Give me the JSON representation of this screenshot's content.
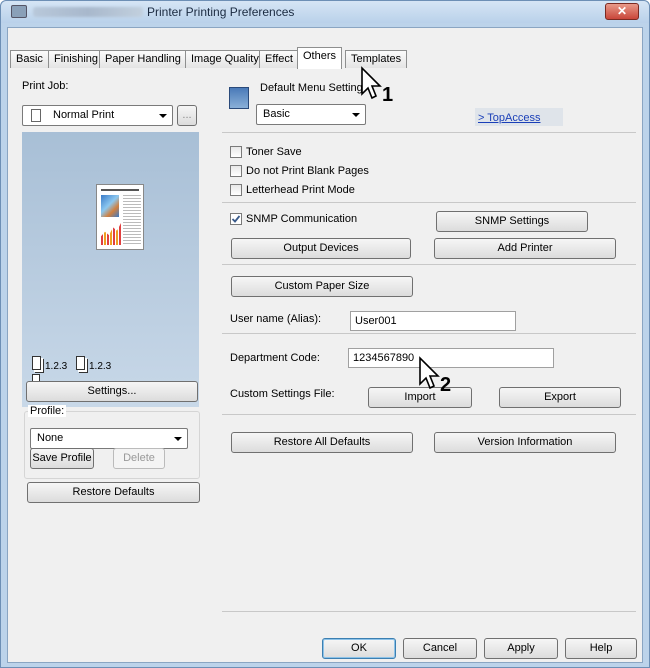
{
  "window": {
    "title": "Printer Printing Preferences",
    "close_label": "✕"
  },
  "tabs": [
    "Basic",
    "Finishing",
    "Paper Handling",
    "Image Quality",
    "Effect",
    "Others",
    "Templates"
  ],
  "left": {
    "print_job_label": "Print Job:",
    "print_job_value": "Normal Print",
    "print_job_more": "...",
    "preview_counts": [
      "1.2.3",
      "1.2.3"
    ],
    "settings_button": "Settings...",
    "profile_label": "Profile:",
    "profile_value": "None",
    "save_profile": "Save Profile",
    "delete": "Delete",
    "restore_defaults": "Restore Defaults"
  },
  "main": {
    "default_menu_label": "Default Menu Setting",
    "default_menu_value": "Basic",
    "topaccess_link": "> TopAccess",
    "toner_save": "Toner Save",
    "no_blank_pages": "Do not Print Blank Pages",
    "letterhead": "Letterhead Print Mode",
    "snmp_communication": "SNMP Communication",
    "snmp_settings": "SNMP Settings",
    "output_devices": "Output Devices",
    "add_printer": "Add Printer",
    "custom_paper_size": "Custom Paper Size",
    "user_name_label": "User name (Alias):",
    "user_name_value": "User001",
    "department_label": "Department Code:",
    "department_value": "1234567890",
    "custom_settings_label": "Custom Settings File:",
    "import": "Import",
    "export": "Export",
    "restore_all": "Restore All Defaults",
    "version_info": "Version Information"
  },
  "footer": {
    "ok": "OK",
    "cancel": "Cancel",
    "apply": "Apply",
    "help": "Help"
  },
  "callouts": [
    "1",
    "2"
  ],
  "checkbox_states": {
    "toner_save": false,
    "no_blank_pages": false,
    "letterhead": false,
    "snmp_communication": true
  }
}
